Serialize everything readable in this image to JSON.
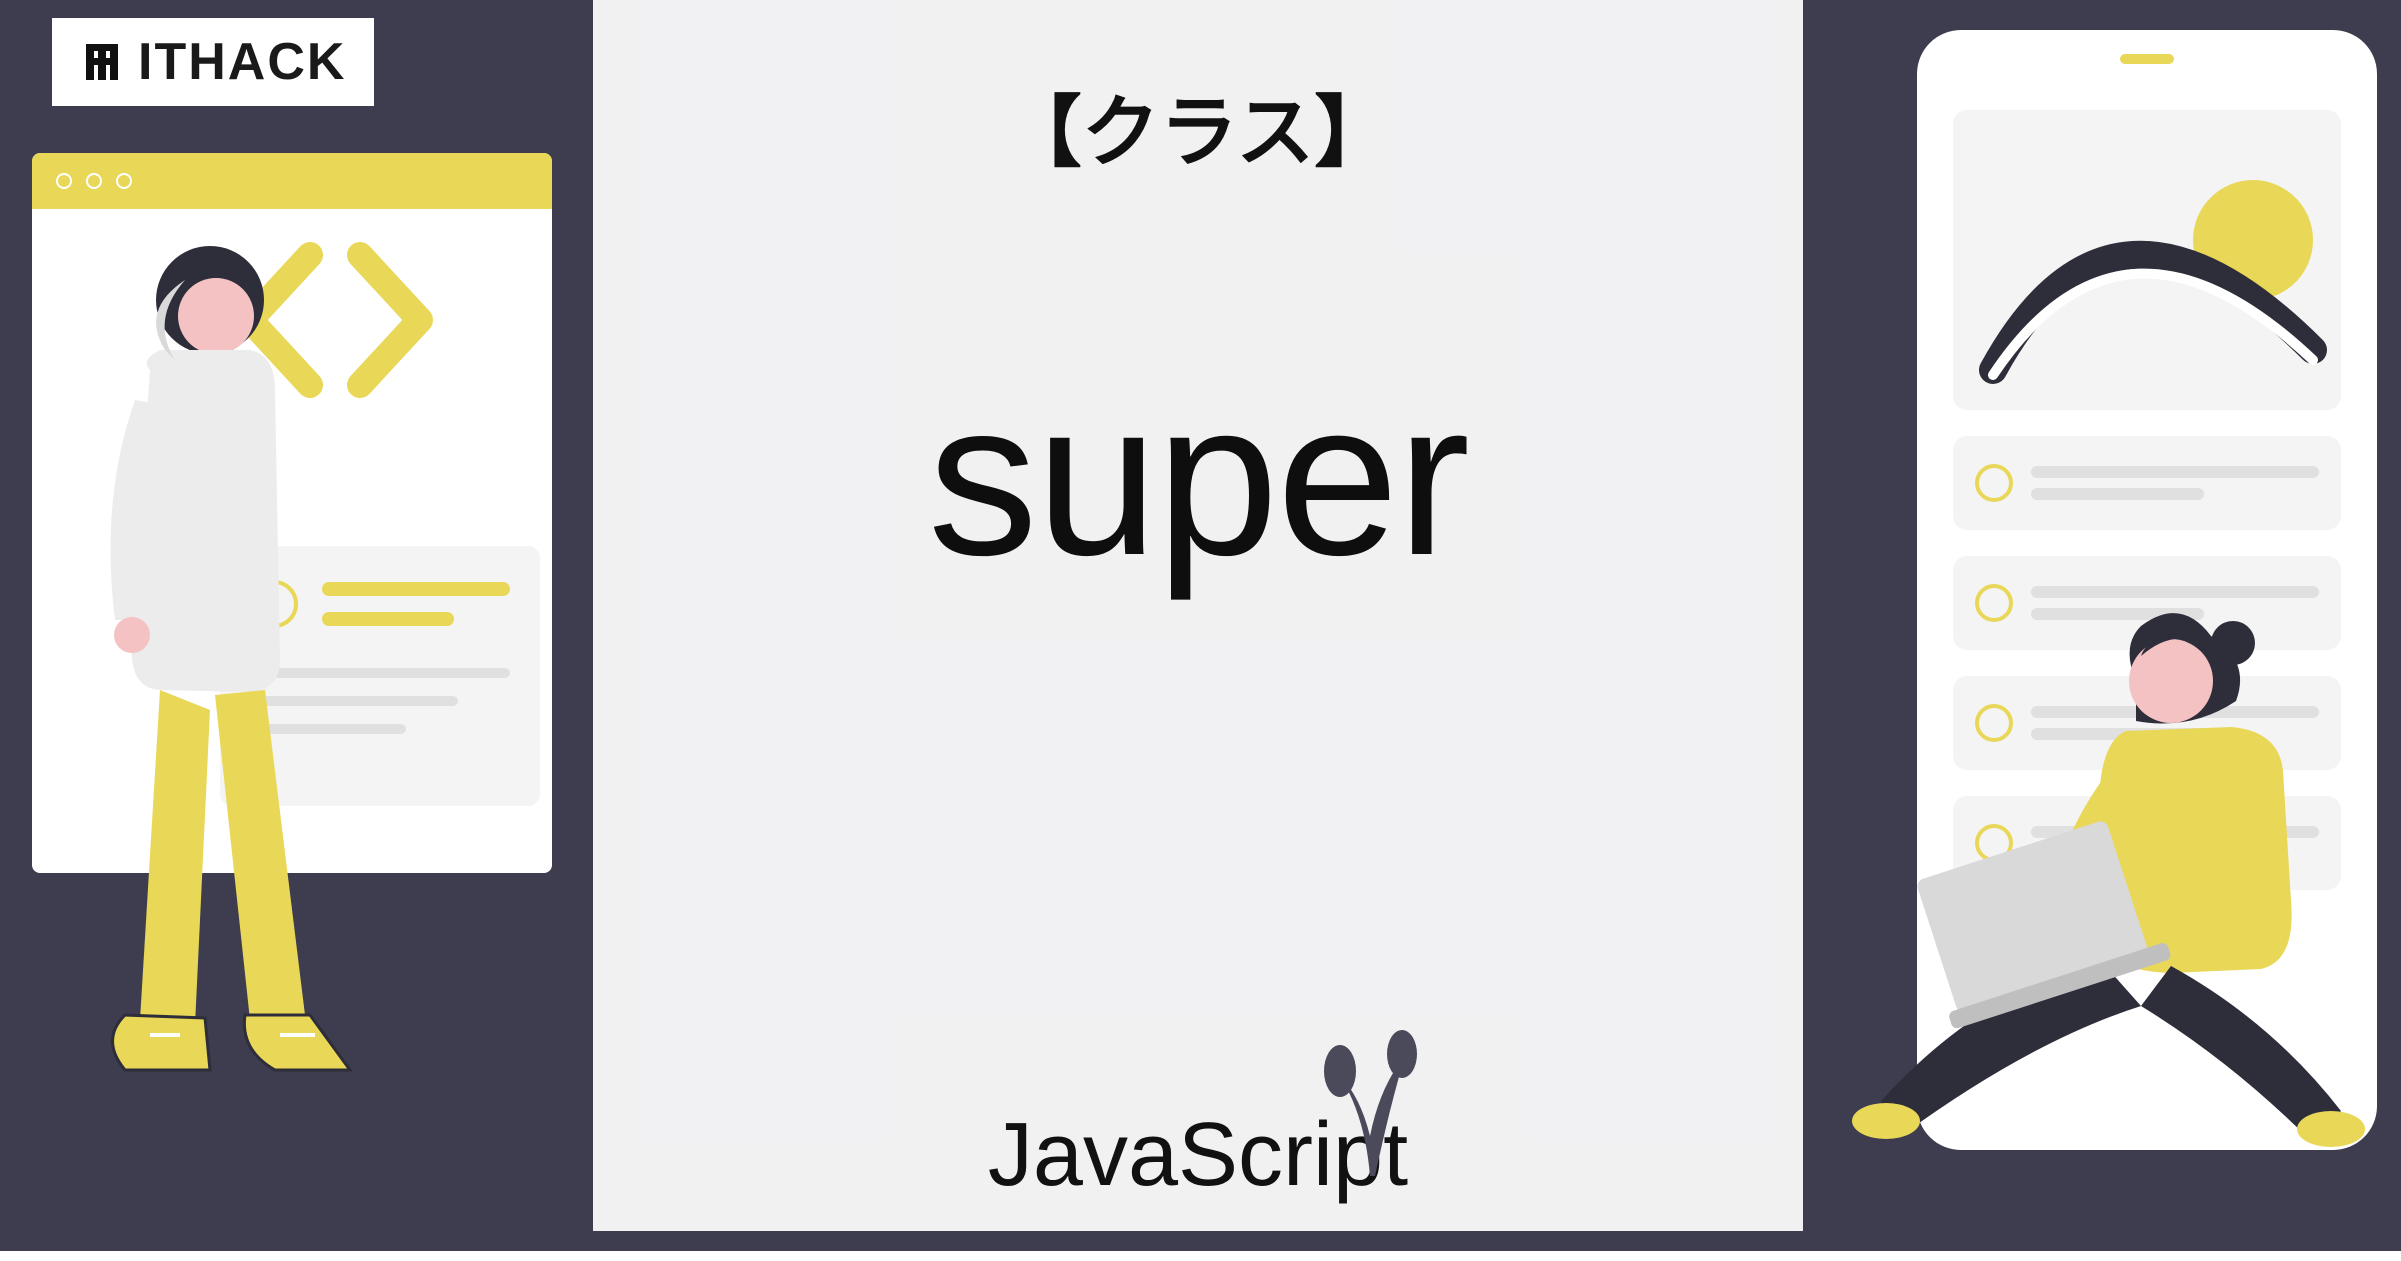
{
  "logo": {
    "text": "ITHACK"
  },
  "card": {
    "subtitle": "【クラス】",
    "main": "super",
    "footer": "JavaScript"
  },
  "colors": {
    "bg": "#3E3C4F",
    "accent": "#E9D758",
    "dark": "#2E2E3A",
    "skin": "#F4C2C2"
  }
}
